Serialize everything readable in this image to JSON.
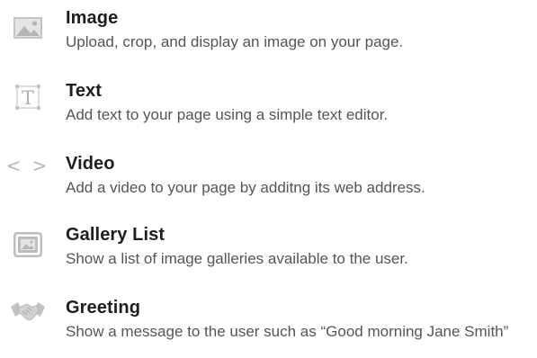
{
  "blocks": [
    {
      "title": "Image",
      "description": "Upload, crop, and display an image on your page.",
      "icon": "image-icon"
    },
    {
      "title": "Text",
      "description": "Add text to your page using a simple text editor.",
      "icon": "text-icon"
    },
    {
      "title": "Video",
      "description": "Add a video to your page by additng its web address.",
      "icon": "code-brackets-icon",
      "icon_glyph": "< >"
    },
    {
      "title": "Gallery List",
      "description": "Show a list of image galleries available to the user.",
      "icon": "gallery-icon"
    },
    {
      "title": "Greeting",
      "description": "Show a message to the user such as “Good morning Jane Smith”",
      "icon": "handshake-icon"
    }
  ],
  "colors": {
    "title": "#1e1e1e",
    "description": "#555555",
    "icon": "#b9b9b9"
  }
}
